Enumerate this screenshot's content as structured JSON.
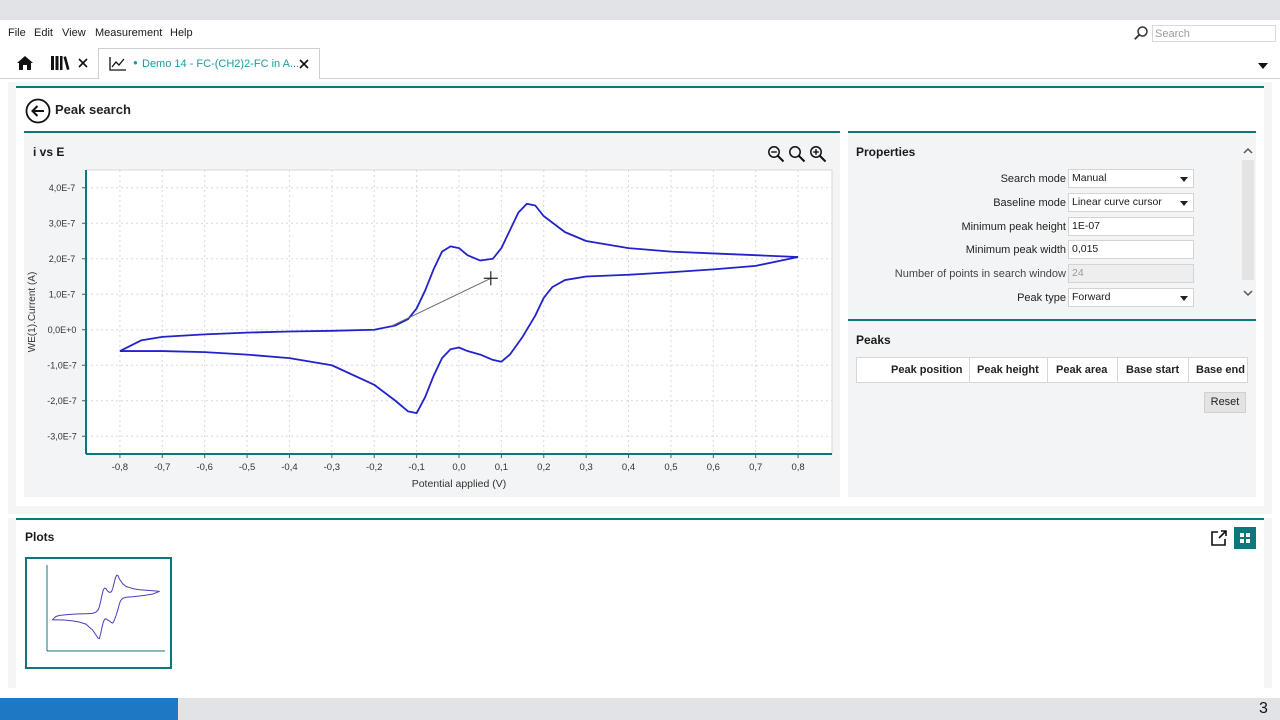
{
  "menu": {
    "items": [
      "File",
      "Edit",
      "View",
      "Measurement",
      "Help"
    ]
  },
  "search": {
    "placeholder": "Search"
  },
  "tabs": {
    "active_label": "Demo 14 - FC-(CH2)2-FC in A..."
  },
  "page": {
    "title": "Peak search"
  },
  "chart_panel": {
    "title": "i vs E"
  },
  "properties": {
    "title": "Properties",
    "rows": [
      {
        "label": "Search mode",
        "value": "Manual",
        "type": "dropdown"
      },
      {
        "label": "Baseline mode",
        "value": "Linear curve cursor",
        "type": "dropdown"
      },
      {
        "label": "Minimum peak height",
        "value": "1E-07",
        "type": "text"
      },
      {
        "label": "Minimum peak width",
        "value": "0,015",
        "type": "text"
      },
      {
        "label": "Number of points in search window",
        "value": "24",
        "type": "disabled"
      },
      {
        "label": "Peak type",
        "value": "Forward",
        "type": "dropdown"
      }
    ]
  },
  "peaks": {
    "title": "Peaks",
    "columns": [
      "Peak position",
      "Peak height",
      "Peak area",
      "Base start",
      "Base end"
    ],
    "reset_label": "Reset"
  },
  "plots": {
    "title": "Plots"
  },
  "status": {
    "page_number": "3"
  },
  "colors": {
    "accent": "#10767e",
    "curve": "#2222cc",
    "status_accent": "#1e78c4"
  },
  "chart_data": {
    "type": "line",
    "xlabel": "Potential applied (V)",
    "ylabel": "WE(1).Current (A)",
    "xlim": [
      -0.88,
      0.88
    ],
    "ylim": [
      -3.5e-07,
      4.5e-07
    ],
    "x_ticks": [
      -0.8,
      -0.7,
      -0.6,
      -0.5,
      -0.4,
      -0.3,
      -0.2,
      -0.1,
      0.0,
      0.1,
      0.2,
      0.3,
      0.4,
      0.5,
      0.6,
      0.7,
      0.8
    ],
    "x_tick_labels": [
      "-0,8",
      "-0,7",
      "-0,6",
      "-0,5",
      "-0,4",
      "-0,3",
      "-0,2",
      "-0,1",
      "0,0",
      "0,1",
      "0,2",
      "0,3",
      "0,4",
      "0,5",
      "0,6",
      "0,7",
      "0,8"
    ],
    "y_ticks": [
      4e-07,
      3e-07,
      2e-07,
      1e-07,
      0,
      -1e-07,
      -2e-07,
      -3e-07
    ],
    "y_tick_labels": [
      "4,0E-7",
      "3,0E-7",
      "2,0E-7",
      "1,0E-7",
      "0,0E+0",
      "-1,0E-7",
      "-2,0E-7",
      "-3,0E-7"
    ],
    "grid": true,
    "series": [
      {
        "x": [
          -0.8,
          -0.75,
          -0.7,
          -0.6,
          -0.5,
          -0.4,
          -0.3,
          -0.2,
          -0.15,
          -0.12,
          -0.1,
          -0.08,
          -0.06,
          -0.04,
          -0.02,
          0.0,
          0.02,
          0.05,
          0.08,
          0.1,
          0.12,
          0.14,
          0.16,
          0.18,
          0.2,
          0.25,
          0.3,
          0.4,
          0.5,
          0.6,
          0.7,
          0.8
        ],
        "y": [
          -6e-08,
          -3e-08,
          -2e-08,
          -1.3e-08,
          -8e-09,
          -5e-09,
          -3e-09,
          0.0,
          1.2e-08,
          3e-08,
          6e-08,
          1.1e-07,
          1.7e-07,
          2.2e-07,
          2.35e-07,
          2.3e-07,
          2.1e-07,
          1.95e-07,
          2e-07,
          2.3e-07,
          2.8e-07,
          3.3e-07,
          3.55e-07,
          3.5e-07,
          3.2e-07,
          2.75e-07,
          2.5e-07,
          2.3e-07,
          2.2e-07,
          2.15e-07,
          2.1e-07,
          2.05e-07
        ]
      },
      {
        "x": [
          0.8,
          0.7,
          0.6,
          0.5,
          0.4,
          0.3,
          0.25,
          0.22,
          0.2,
          0.18,
          0.15,
          0.12,
          0.1,
          0.08,
          0.05,
          0.02,
          0.0,
          -0.02,
          -0.04,
          -0.06,
          -0.08,
          -0.1,
          -0.12,
          -0.15,
          -0.2,
          -0.3,
          -0.4,
          -0.5,
          -0.6,
          -0.7,
          -0.8
        ],
        "y": [
          2.05e-07,
          1.8e-07,
          1.7e-07,
          1.62e-07,
          1.55e-07,
          1.5e-07,
          1.4e-07,
          1.2e-07,
          9e-08,
          4e-08,
          -2e-08,
          -7e-08,
          -9e-08,
          -8.5e-08,
          -7e-08,
          -6e-08,
          -5e-08,
          -5.5e-08,
          -8e-08,
          -1.3e-07,
          -1.9e-07,
          -2.35e-07,
          -2.3e-07,
          -2e-07,
          -1.55e-07,
          -1e-07,
          -8e-08,
          -7e-08,
          -6.3e-08,
          -6e-08,
          -6e-08
        ]
      }
    ],
    "baseline": {
      "x": [
        -0.16,
        0.075
      ],
      "y": [
        1e-08,
        1.45e-07
      ]
    }
  }
}
